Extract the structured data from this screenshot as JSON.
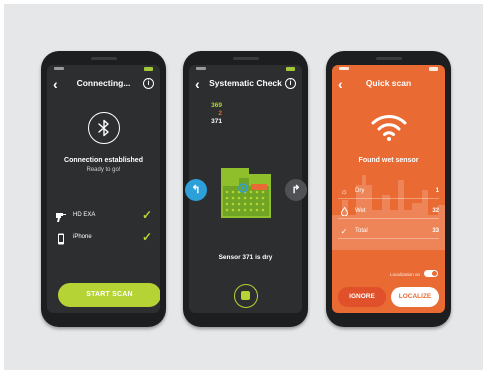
{
  "colors": {
    "lime": "#b5d334",
    "orange": "#e96a33",
    "dark": "#2d2e30",
    "blue": "#2d9fd9"
  },
  "phone1": {
    "title": "Connecting...",
    "bluetooth_icon": "bluetooth-icon",
    "status_title": "Connection established",
    "status_subtitle": "Ready to go!",
    "devices": [
      {
        "label": "HD EXA",
        "icon": "drill-icon",
        "connected": true
      },
      {
        "label": "iPhone",
        "icon": "phone-icon",
        "connected": true
      }
    ],
    "start_button": "START SCAN"
  },
  "phone2": {
    "title": "Systematic Check",
    "sensor_numbers": [
      "369",
      "2",
      "371"
    ],
    "sensor_number_colors": [
      "#b5d334",
      "#e96a33",
      "#ffffff"
    ],
    "status": "Sensor 371 is dry"
  },
  "phone3": {
    "title": "Quick scan",
    "found_title": "Found wet sensor",
    "results": [
      {
        "label": "Dry",
        "value": "1",
        "icon": "sun-icon"
      },
      {
        "label": "Wet",
        "value": "32",
        "icon": "drop-icon"
      },
      {
        "label": "Total",
        "value": "33",
        "icon": "check-icon"
      }
    ],
    "localization_label": "Localization on",
    "localization_on": true,
    "ignore_button": "IGNORE",
    "localize_button": "LOCALIZE"
  }
}
